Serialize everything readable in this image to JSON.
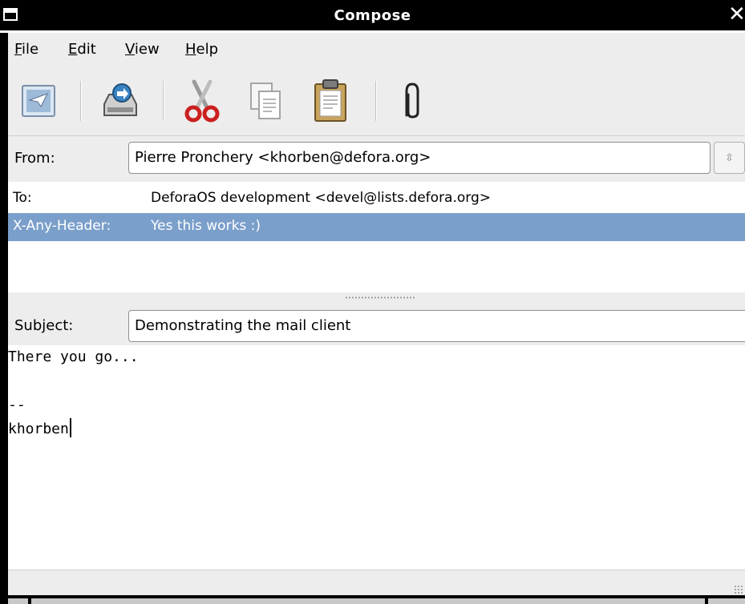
{
  "window": {
    "title": "Compose",
    "close_glyph": "✕"
  },
  "menubar": {
    "items": [
      {
        "mnemonic": "F",
        "rest": "ile"
      },
      {
        "mnemonic": "E",
        "rest": "dit"
      },
      {
        "mnemonic": "V",
        "rest": "iew"
      },
      {
        "mnemonic": "H",
        "rest": "elp"
      }
    ]
  },
  "toolbar": {
    "buttons": [
      "send-icon",
      "save-icon",
      "cut-icon",
      "copy-icon",
      "paste-icon",
      "attach-icon"
    ]
  },
  "from": {
    "label": "From:",
    "value": "Pierre Pronchery <khorben@defora.org>",
    "arrow_glyph": "⇳"
  },
  "headers": [
    {
      "name": "To:",
      "value": "DeforaOS development <devel@lists.defora.org>",
      "selected": false
    },
    {
      "name": "X-Any-Header:",
      "value": "Yes this works :)",
      "selected": true
    }
  ],
  "subject": {
    "label": "Subject:",
    "value": "Demonstrating the mail client"
  },
  "body": {
    "lines": [
      "There you go...",
      "",
      "--",
      "khorben"
    ]
  },
  "colors": {
    "selection": "#7b9fcb",
    "window_bg": "#ededed"
  }
}
